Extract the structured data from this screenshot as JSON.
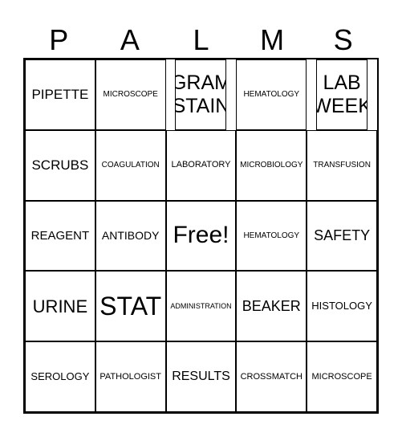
{
  "header": {
    "letters": [
      "P",
      "A",
      "L",
      "M",
      "S"
    ]
  },
  "cells": [
    "PIPETTE",
    "MICROSCOPE",
    "GRAM STAIN",
    "HEMATOLOGY",
    "LAB WEEK",
    "SCRUBS",
    "COAGULATION",
    "LABORATORY",
    "MICROBIOLOGY",
    "TRANSFUSION",
    "REAGENT",
    "ANTIBODY",
    "Free!",
    "HEMATOLOGY",
    "SAFETY",
    "URINE",
    "STAT",
    "ADMINISTRATION",
    "BEAKER",
    "HISTOLOGY",
    "SEROLOGY",
    "PATHOLOGIST",
    "RESULTS",
    "CROSSMATCH",
    "MICROSCOPE"
  ]
}
